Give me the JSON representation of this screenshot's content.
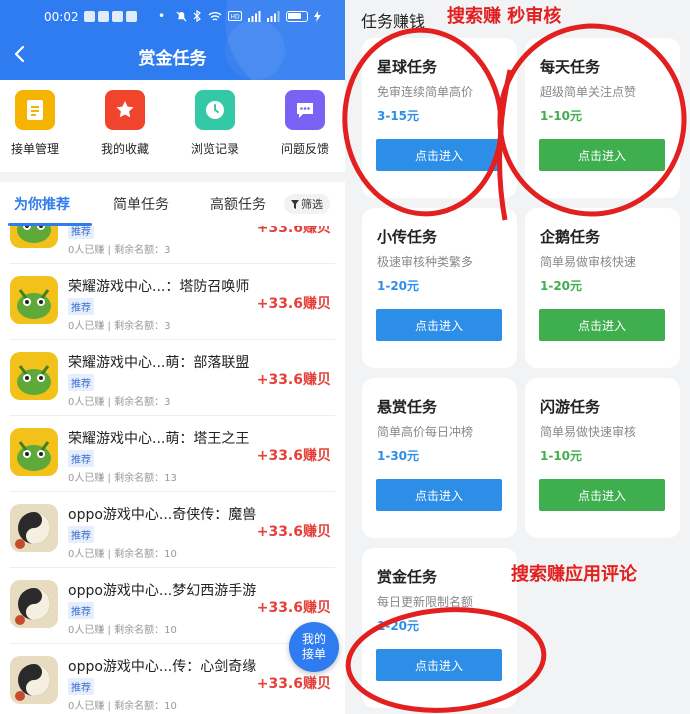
{
  "status_bar": {
    "time": "00:02",
    "dot": "•"
  },
  "header": {
    "title": "赏金任务"
  },
  "quick_actions": [
    {
      "label": "接单管理",
      "icon": "clipboard-icon",
      "color": "#f5b400"
    },
    {
      "label": "我的收藏",
      "icon": "star-icon",
      "color": "#f0442c"
    },
    {
      "label": "浏览记录",
      "icon": "clock-icon",
      "color": "#33c9a7"
    },
    {
      "label": "问题反馈",
      "icon": "chat-bubble-icon",
      "color": "#7a62f5"
    }
  ],
  "tabs": [
    {
      "label": "为你推荐",
      "active": true
    },
    {
      "label": "简单任务",
      "active": false
    },
    {
      "label": "高额任务",
      "active": false
    }
  ],
  "filter_label": "筛选",
  "list": [
    {
      "title": "",
      "tag": "推荐",
      "meta": "0人已赚 | 剩余名额：3",
      "reward": "+33.6赚贝",
      "icon": "dragon-game-icon"
    },
    {
      "title": "荣耀游戏中心...：塔防召唤师",
      "tag": "推荐",
      "meta": "0人已赚 | 剩余名额：3",
      "reward": "+33.6赚贝",
      "icon": "dragon-game-icon"
    },
    {
      "title": "荣耀游戏中心...萌：部落联盟",
      "tag": "推荐",
      "meta": "0人已赚 | 剩余名额：3",
      "reward": "+33.6赚贝",
      "icon": "dragon-game-icon"
    },
    {
      "title": "荣耀游戏中心...萌：塔王之王",
      "tag": "推荐",
      "meta": "0人已赚 | 剩余名额：13",
      "reward": "+33.6赚贝",
      "icon": "dragon-game-icon"
    },
    {
      "title": "oppo游戏中心...奇侠传：魔兽",
      "tag": "推荐",
      "meta": "0人已赚 | 剩余名额：10",
      "reward": "+33.6赚贝",
      "icon": "yinyang-game-icon"
    },
    {
      "title": "oppo游戏中心...梦幻西游手游",
      "tag": "推荐",
      "meta": "0人已赚 | 剩余名额：10",
      "reward": "+33.6赚贝",
      "icon": "yinyang-game-icon"
    },
    {
      "title": "oppo游戏中心...传：心剑奇缘",
      "tag": "推荐",
      "meta": "0人已赚 | 剩余名额：10",
      "reward": "+33.6赚贝",
      "icon": "yinyang-game-icon"
    }
  ],
  "floating_button": {
    "line1": "我的",
    "line2": "接单"
  },
  "right": {
    "heading": "任务赚钱",
    "annotation_top": "搜索赚 秒审核",
    "annotation_bottom": "搜索赚应用评论",
    "cards": [
      {
        "title": "星球任务",
        "subtitle": "免审连续简单高价",
        "range": "3-15元",
        "button": "点击进入",
        "accent": "#2d8ee8"
      },
      {
        "title": "每天任务",
        "subtitle": "超级简单关注点赞",
        "range": "1-10元",
        "button": "点击进入",
        "accent": "#3fae4f"
      },
      {
        "title": "小传任务",
        "subtitle": "极速审核种类繁多",
        "range": "1-20元",
        "button": "点击进入",
        "accent": "#2d8ee8"
      },
      {
        "title": "企鹅任务",
        "subtitle": "简单易做审核快速",
        "range": "1-20元",
        "button": "点击进入",
        "accent": "#3fae4f"
      },
      {
        "title": "悬赏任务",
        "subtitle": "简单高价每日冲榜",
        "range": "1-30元",
        "button": "点击进入",
        "accent": "#2d8ee8"
      },
      {
        "title": "闪游任务",
        "subtitle": "简单易做快速审核",
        "range": "1-10元",
        "button": "点击进入",
        "accent": "#3fae4f"
      },
      {
        "title": "赏金任务",
        "subtitle": "每日更新限制名额",
        "range": "1-20元",
        "button": "点击进入",
        "accent": "#2d8ee8"
      }
    ]
  }
}
